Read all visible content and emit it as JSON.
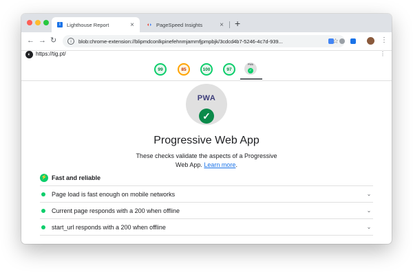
{
  "browser": {
    "tabs": [
      {
        "title": "Lighthouse Report",
        "active": true
      },
      {
        "title": "PageSpeed Insights",
        "active": false
      }
    ],
    "new_tab": "+",
    "url": "blob:chrome-extension://blipmdconlkpinefehnmjammfjpmpbjk/3cdcd4b7-5246-4c7d-939...",
    "close_glyph": "×",
    "back_glyph": "←",
    "forward_glyph": "→",
    "reload_glyph": "↻",
    "star_glyph": "☆",
    "menu_glyph": "⋮",
    "info_glyph": "i"
  },
  "report": {
    "site_url": "https://tig.pt/",
    "logo_glyph": "◐",
    "more_glyph": "⋮",
    "scores": [
      "99",
      "85",
      "100",
      "97"
    ],
    "pwa_badge_text": "PWA",
    "check_glyph": "✓",
    "category": {
      "badge_label": "PWA",
      "title": "Progressive Web App",
      "description_before_link": "These checks validate the aspects of a Progressive Web App. ",
      "link_text": "Learn more",
      "description_after_link": "."
    },
    "group": {
      "title": "Fast and reliable",
      "icon_glyph": "⚡"
    },
    "audits": [
      {
        "title": "Page load is fast enough on mobile networks"
      },
      {
        "title": "Current page responds with a 200 when offline"
      },
      {
        "title": "start_url responds with a 200 when offline"
      }
    ],
    "chevron_glyph": "⌄"
  },
  "colors": {
    "pass": "#0cce6b",
    "average": "#ffa400",
    "link": "#1a73e8"
  }
}
